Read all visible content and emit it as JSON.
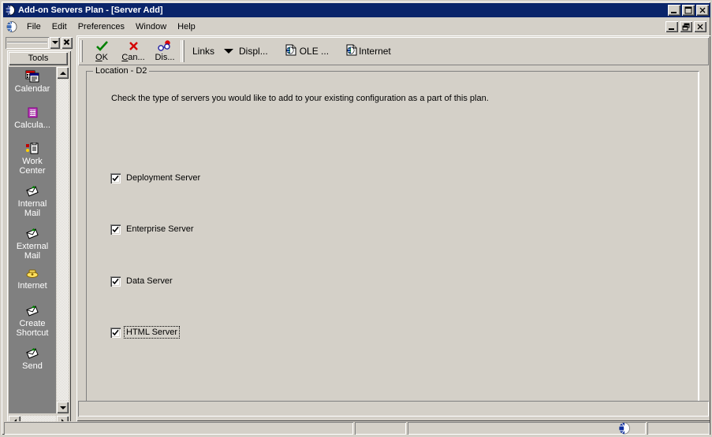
{
  "window": {
    "title": "Add-on Servers Plan - [Server Add]",
    "icon": "globe-icon",
    "buttons": [
      {
        "name": "minimize-button",
        "glyph": "minimize"
      },
      {
        "name": "maximize-button",
        "glyph": "maximize"
      },
      {
        "name": "close-button",
        "glyph": "close"
      }
    ]
  },
  "menubar": {
    "icon": "mdi-globe-icon",
    "items": [
      {
        "label": "File"
      },
      {
        "label": "Edit"
      },
      {
        "label": "Preferences"
      },
      {
        "label": "Window"
      },
      {
        "label": "Help"
      }
    ],
    "mdi_buttons": [
      {
        "name": "mdi-minimize-button",
        "glyph": "minimize"
      },
      {
        "name": "mdi-restore-button",
        "glyph": "restore"
      },
      {
        "name": "mdi-close-button",
        "glyph": "close"
      }
    ]
  },
  "sidebar": {
    "combo_value": "",
    "close_label": "✖",
    "header": "Tools",
    "items": [
      {
        "label": "Calendar",
        "icon": "calendar-icon"
      },
      {
        "label": "Calcula...",
        "icon": "calculator-icon"
      },
      {
        "label": "Work\nCenter",
        "icon": "work-center-icon"
      },
      {
        "label": "Internal\nMail",
        "icon": "mail-icon"
      },
      {
        "label": "External\nMail",
        "icon": "mail-icon"
      },
      {
        "label": "Internet",
        "icon": "telephone-icon"
      },
      {
        "label": "Create\nShortcut",
        "icon": "shortcut-icon"
      },
      {
        "label": "Send",
        "icon": "send-icon"
      }
    ]
  },
  "toolbar": {
    "buttons": [
      {
        "name": "ok-button",
        "label": "OK",
        "icon": "green-check-icon",
        "accesskey": "O"
      },
      {
        "name": "cancel-button",
        "label": "Can...",
        "icon": "red-x-icon",
        "accesskey": "C"
      },
      {
        "name": "display-button",
        "label": "Dis...",
        "icon": "glasses-icon"
      }
    ],
    "links_label": "Links",
    "display_label": "Displ...",
    "ole_label": "OLE ...",
    "internet_label": "Internet"
  },
  "form": {
    "group_legend": "Location - D2",
    "instruction": "Check the type of servers you would like to add to your existing configuration as a part of this plan.",
    "checkboxes": [
      {
        "label": "Deployment Server",
        "checked": true,
        "focused": false
      },
      {
        "label": "Enterprise Server",
        "checked": true,
        "focused": false
      },
      {
        "label": "Data Server",
        "checked": true,
        "focused": false
      },
      {
        "label": "HTML Server",
        "checked": true,
        "focused": true
      }
    ]
  },
  "statusbar": {
    "panels": [
      "",
      "",
      "",
      ""
    ],
    "icon": "globe-icon"
  },
  "colors": {
    "titlebar": "#0a246a",
    "face": "#d4d0c8",
    "sidebar": "#808080",
    "check": "#000000",
    "ok_icon": "#008000",
    "cancel_icon": "#d40000"
  }
}
